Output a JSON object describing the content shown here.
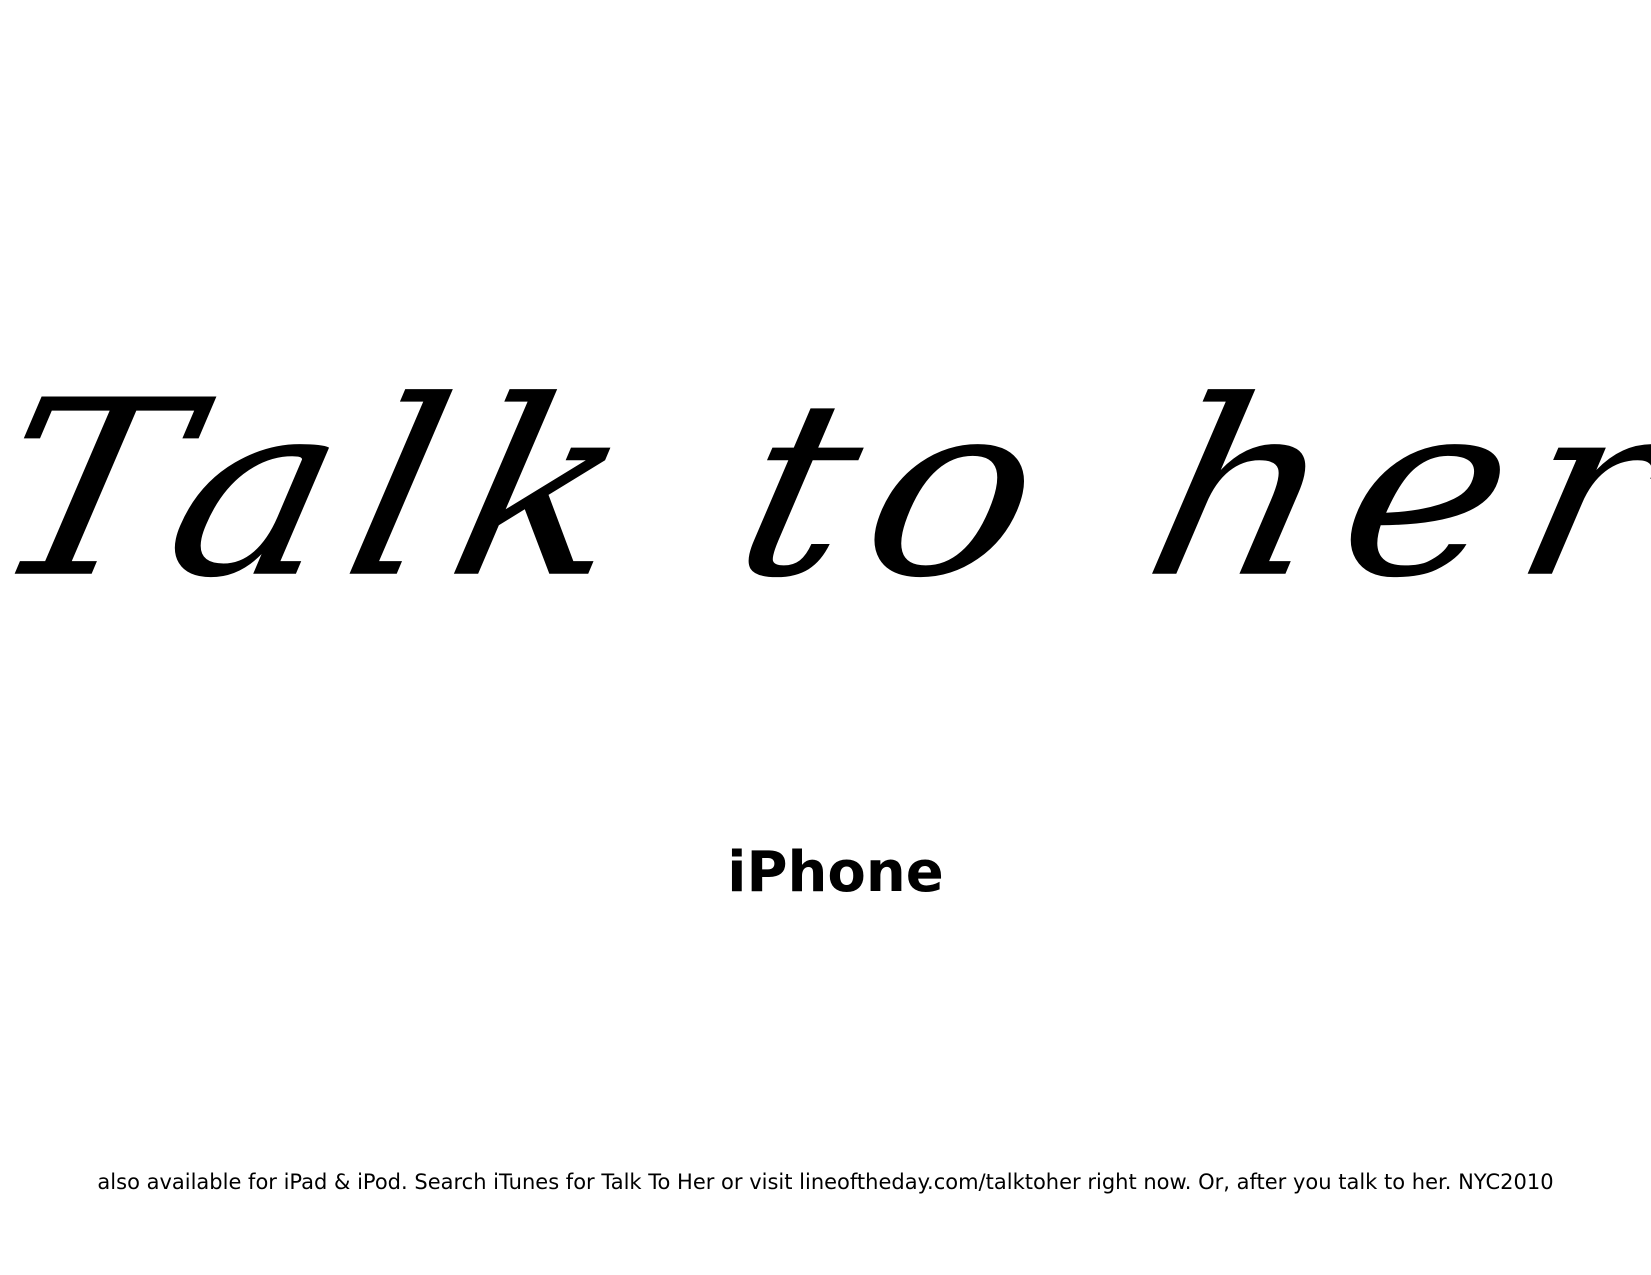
{
  "poster": {
    "headline": "Talk to her",
    "product": "iPhone",
    "footer": "also available for iPad & iPod.  Search iTunes for Talk To Her or visit lineoftheday.com/talktoher right now.  Or, after you talk to her. NYC2010"
  },
  "colors": {
    "background": "#ffffff",
    "text": "#000000"
  }
}
